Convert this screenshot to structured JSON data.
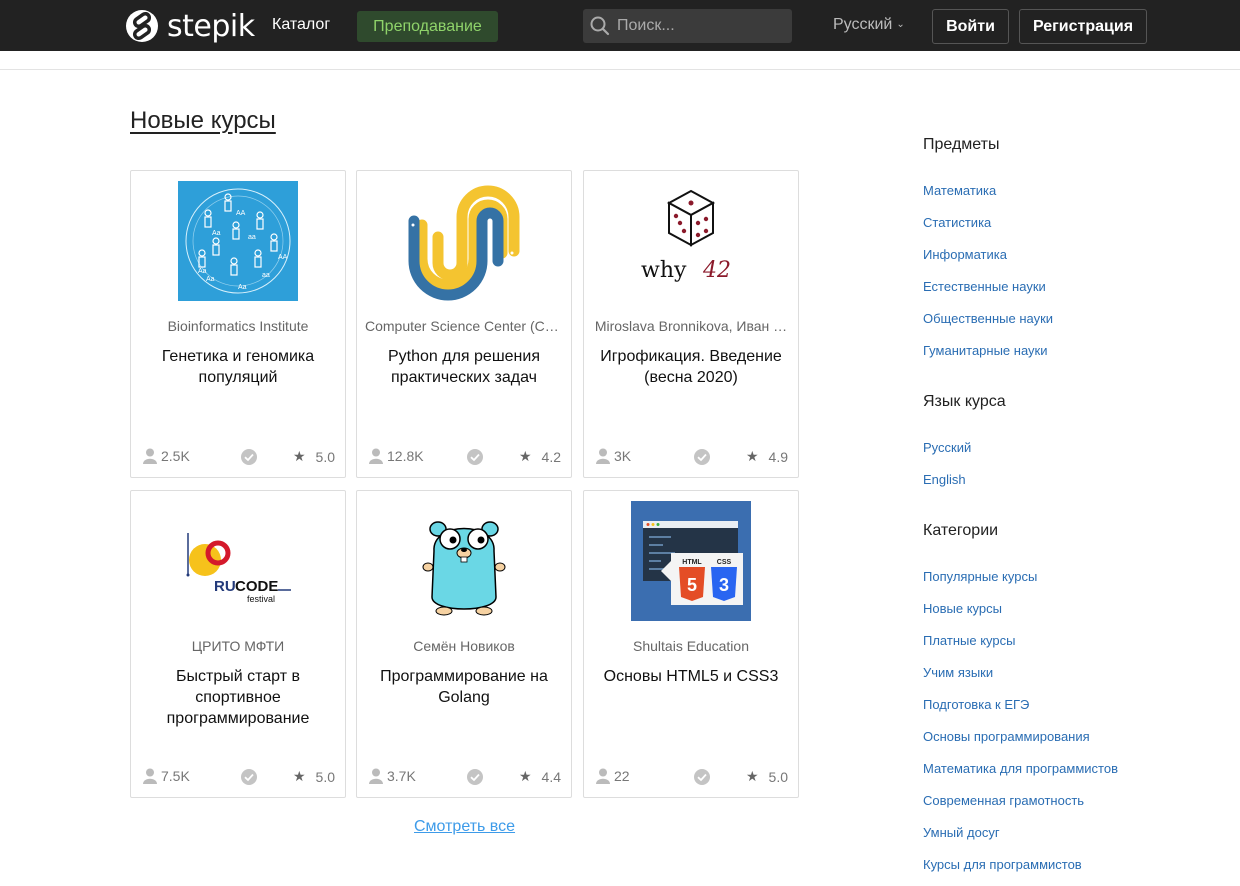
{
  "header": {
    "logo_text": "stepik",
    "catalog": "Каталог",
    "teaching": "Преподавание",
    "search_placeholder": "Поиск...",
    "language": "Русский",
    "login": "Войти",
    "register": "Регистрация"
  },
  "main": {
    "section_title": "Новые курсы",
    "see_all": "Смотреть все",
    "courses": [
      {
        "author": "Bioinformatics Institute",
        "title": "Генетика и геномика популяций",
        "learners": "2.5K",
        "rating": "5.0",
        "image_icon": "bioinformatics-people-icon"
      },
      {
        "author": "Computer Science Center (CS…",
        "title": "Python для решения практических задач",
        "learners": "12.8K",
        "rating": "4.2",
        "image_icon": "python-snake-icon"
      },
      {
        "author": "Miroslava Bronnikova,  Иван …",
        "title": "Игрофикация. Введение (весна 2020)",
        "learners": "3K",
        "rating": "4.9",
        "image_icon": "dice-why42-icon",
        "image_text": "why 42"
      },
      {
        "author": "ЦРИТО МФТИ",
        "title": "Быстрый старт в спортивное программирование",
        "learners": "7.5K",
        "rating": "5.0",
        "image_icon": "rucode-logo-icon",
        "image_text": "RUCODE festival"
      },
      {
        "author": "Семён Новиков",
        "title": "Программирование на Golang",
        "learners": "3.7K",
        "rating": "4.4",
        "image_icon": "gopher-icon"
      },
      {
        "author": "Shultais Education",
        "title": "Основы HTML5 и CSS3",
        "learners": "22",
        "rating": "5.0",
        "image_icon": "html5-css3-icon",
        "image_text": "HTML CSS"
      }
    ]
  },
  "sidebar": {
    "subjects_title": "Предметы",
    "subjects": [
      "Математика",
      "Статистика",
      "Информатика",
      "Естественные науки",
      "Общественные науки",
      "Гуманитарные науки"
    ],
    "language_title": "Язык курса",
    "languages": [
      "Русский",
      "English"
    ],
    "categories_title": "Категории",
    "categories": [
      "Популярные курсы",
      "Новые курсы",
      "Платные курсы",
      "Учим языки",
      "Подготовка к ЕГЭ",
      "Основы программирования",
      "Математика для программистов",
      "Современная грамотность",
      "Умный досуг",
      "Курсы для программистов"
    ]
  },
  "colors": {
    "topbar": "#222222",
    "teach_button_bg": "#2f4a2d",
    "teach_button_text": "#8fd36a",
    "link": "#2a6db3",
    "see_all": "#3d9be9"
  }
}
